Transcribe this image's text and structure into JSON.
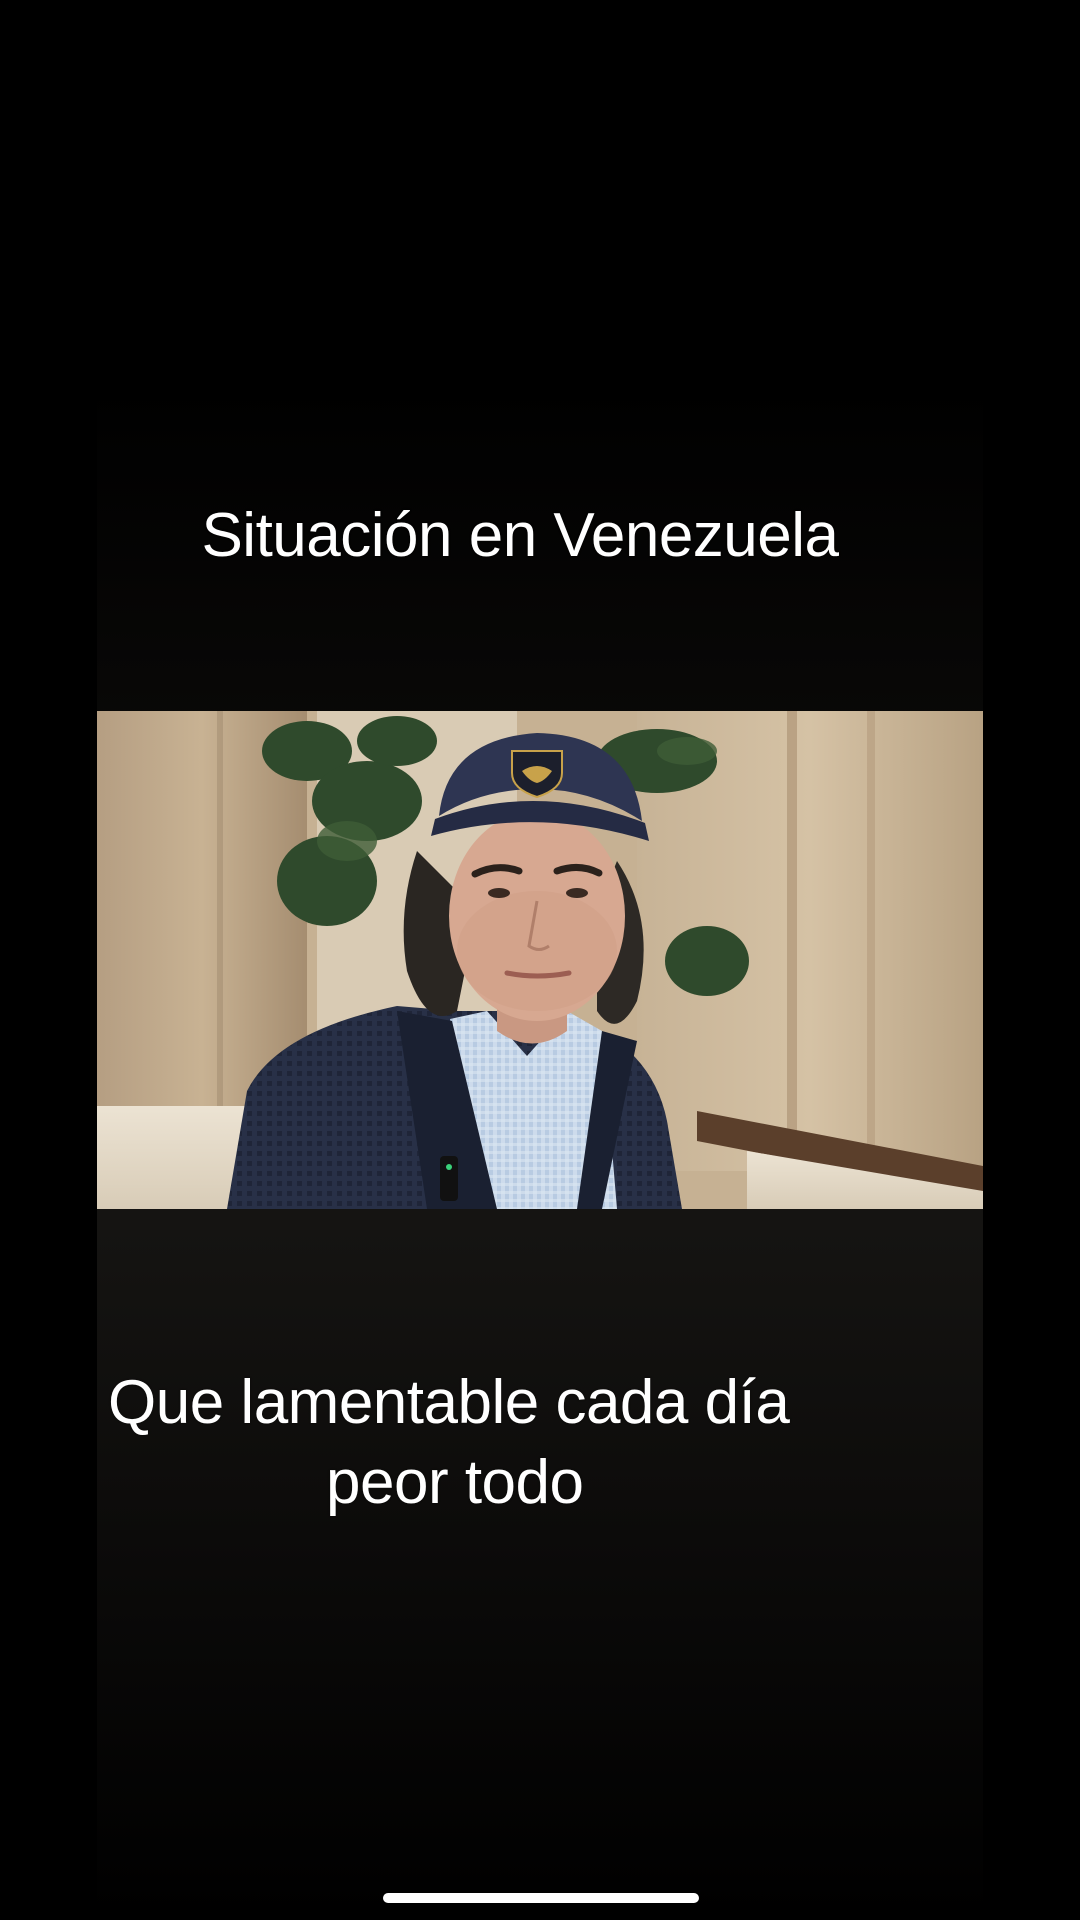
{
  "caption_top": "Situación en Venezuela",
  "caption_bottom": {
    "line1": "Que lamentable cada día",
    "line2": "peor todo"
  },
  "colors": {
    "background": "#000000",
    "caption_text": "#ffffff",
    "home_indicator": "#ffffff"
  },
  "icons": {
    "cap_logo": "lamborghini-bull-shield-icon"
  }
}
